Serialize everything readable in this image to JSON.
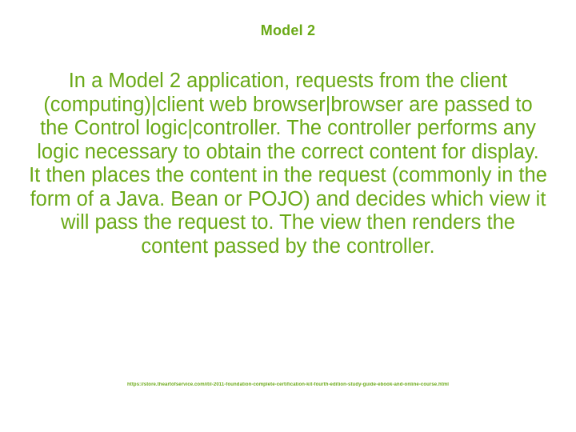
{
  "slide": {
    "title": "Model 2",
    "body": "In a Model 2 application, requests from the client (computing)|client web browser|browser are passed to the Control logic|controller. The controller performs any logic necessary to obtain the correct content for display. It then places the content in the request (commonly in the form of a Java. Bean or POJO) and decides which view it will pass the request to. The view then renders the content passed by the controller.",
    "footer_url": "https://store.theartofservice.com/itil-2011-foundation-complete-certification-kit-fourth-edition-study-guide-ebook-and-online-course.html"
  }
}
